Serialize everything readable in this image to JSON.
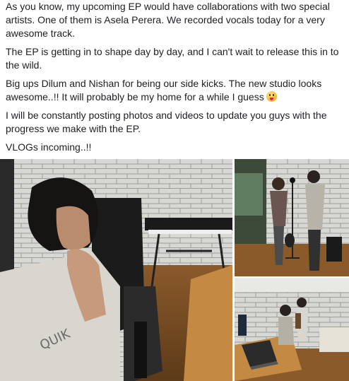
{
  "post": {
    "paragraphs": [
      "As you know, my upcoming EP would have collaborations with two special artists. One of them is Asela Perera. We recorded vocals today for a very awesome track.",
      "The EP is getting in to shape day by day, and I can't wait to release this in to the wild.",
      "Big ups Dilum and Nishan for being our side kicks. The new studio looks awesome..!! It will probably be my home for a while I guess",
      "I will be constantly posting photos and videos to update you guys with the progress we make with the EP.",
      "VLOGs incoming..!!"
    ],
    "emoji": "tongue-out-emoji"
  },
  "photos": {
    "main": "studio-musician-at-desk-photo",
    "top_right": "vocal-recording-booth-photo",
    "bottom_right": "studio-control-room-photo"
  }
}
